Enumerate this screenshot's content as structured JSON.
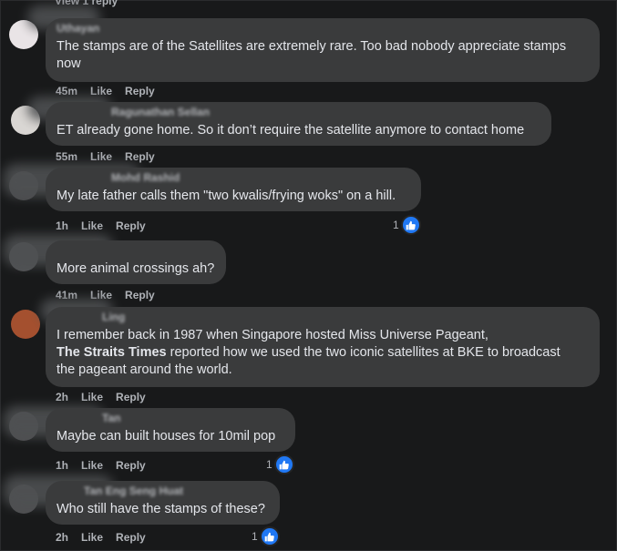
{
  "top_link": "View 1 reply",
  "comments": [
    {
      "author": "Uthayan",
      "text": "The stamps are of the Satellites are extremely rare. Too bad nobody appreciate stamps now",
      "time": "45m",
      "like": "Like",
      "reply": "Reply",
      "reactions": ""
    },
    {
      "author": "Ragunathan Sellan",
      "text": "ET already gone home. So it don’t require the satellite anymore to contact home",
      "time": "55m",
      "like": "Like",
      "reply": "Reply",
      "reactions": ""
    },
    {
      "author": "Mohd Rashid",
      "text": "My late father calls them \"two kwalis/frying woks\" on a hill.",
      "time": "1h",
      "like": "Like",
      "reply": "Reply",
      "reactions": "1"
    },
    {
      "author": "",
      "text": "More animal crossings ah?",
      "time": "41m",
      "like": "Like",
      "reply": "Reply",
      "reactions": ""
    },
    {
      "author": "Ling",
      "text_line1": "I remember back in 1987 when Singapore hosted Miss Universe Pageant,",
      "text_bold": "The Straits Times",
      "text_line2_rest": " reported how we used the two iconic satellites at BKE to broadcast",
      "text_line3": "the pageant around the world.",
      "time": "2h",
      "like": "Like",
      "reply": "Reply",
      "reactions": ""
    },
    {
      "author": "Tan",
      "text": "Maybe can built houses for 10mil pop",
      "time": "1h",
      "like": "Like",
      "reply": "Reply",
      "reactions": "1"
    },
    {
      "author": "Tan Eng Seng Huat",
      "text": "Who still have the stamps of these?",
      "time": "2h",
      "like": "Like",
      "reply": "Reply",
      "reactions": "1"
    }
  ],
  "icons": {
    "like_reaction": "thumbs-up-icon"
  },
  "colors": {
    "background": "#18191a",
    "bubble": "#3a3b3c",
    "meta": "#b0b3b8",
    "like_blue": "#2078f4"
  }
}
